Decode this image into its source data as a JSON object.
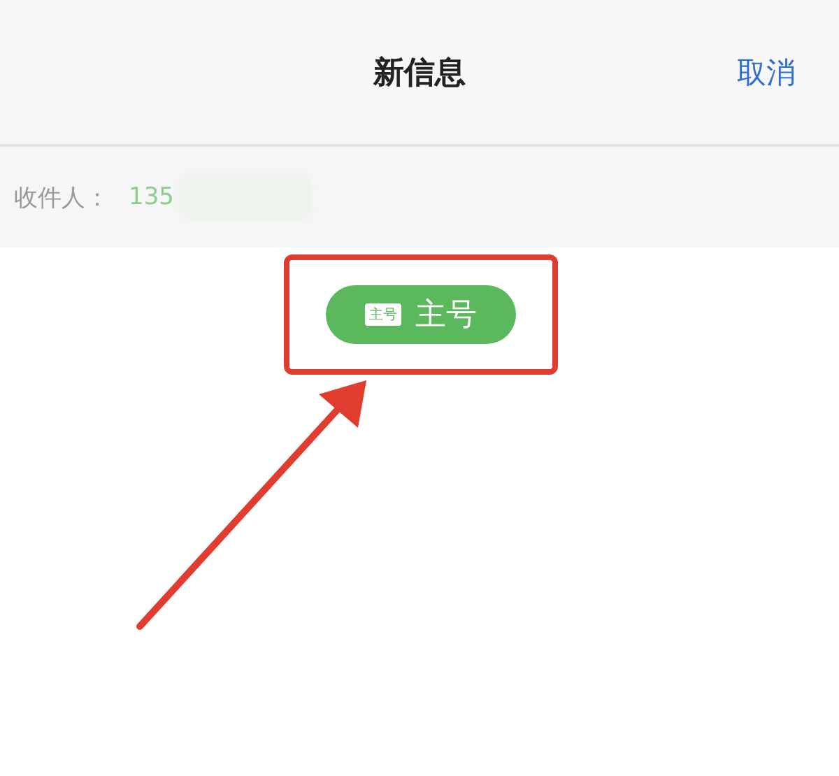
{
  "header": {
    "title": "新信息",
    "cancel": "取消"
  },
  "recipient": {
    "label": "收件人：",
    "number": "135"
  },
  "sim_badge": {
    "tag": "主号",
    "label": "主号"
  }
}
